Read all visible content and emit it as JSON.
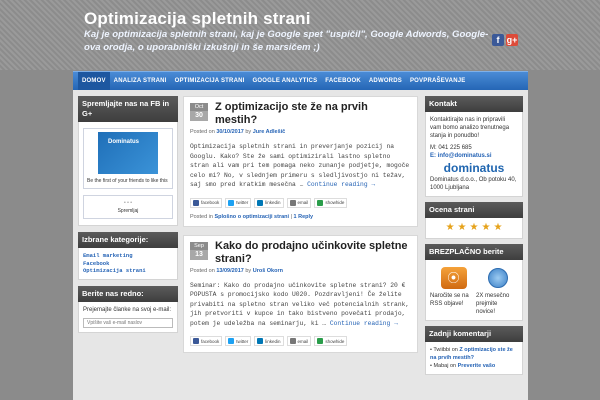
{
  "site": {
    "title": "Optimizacija spletnih strani",
    "tagline": "Kaj je optimizacija spletnih strani, kaj je Google spet \"uspičil\", Google Adwords, Google-ova orodja, o uporabniški izkušnji in še marsičem ;)"
  },
  "social_icons": [
    "facebook-icon",
    "google-plus-icon"
  ],
  "nav": [
    "DOMOV",
    "ANALIZA STRANI",
    "OPTIMIZACIJA STRANI",
    "GOOGLE ANALYTICS",
    "FACEBOOK",
    "ADWORDS",
    "POVPRAŠEVANJE"
  ],
  "left": {
    "fb_title": "Spremljajte nas na FB in G+",
    "fb_page_name": "Dominatus",
    "fb_friends": "Be the first of your friends to like this",
    "follow_btn": "Spremljaj",
    "categories_title": "Izbrane kategorije:",
    "categories": [
      "Email marketing",
      "Facebook",
      "Optimizacija strani"
    ],
    "newsletter_title": "Berite nas redno:",
    "newsletter_text": "Prejemajte članke na svoj e-mail:",
    "newsletter_placeholder": "Vpišite vaš e-mail naslov"
  },
  "posts": [
    {
      "day_label": "Oct",
      "day": "30",
      "title": "Z optimizacijo ste že na prvih mestih?",
      "posted_on": "Posted on",
      "date": "30/10/2017",
      "by": "by",
      "author": "Jure Adlešič",
      "excerpt": "Optimizacija spletnih strani in preverjanje pozicij na Googlu. Kako? Ste že sami optimizirali lastno spletno stran ali vam pri tem pomaga neko zunanje podjetje, mogoče celo mi? No, v slednjem primeru s sledljivostjo ni težav, saj smo pred kratkim mesečna …",
      "more": "Continue reading →",
      "shares": [
        "facebook",
        "twitter",
        "linkedin",
        "email",
        "showhide"
      ],
      "posted_in": "Posted in",
      "category": "Splošno o optimizaciji strani",
      "reply": "1 Reply"
    },
    {
      "day_label": "Sep",
      "day": "13",
      "title": "Kako do prodajno učinkovite spletne strani?",
      "posted_on": "Posted on",
      "date": "13/09/2017",
      "by": "by",
      "author": "Uroš Okorn",
      "excerpt": "Seminar: Kako do prodajno učinkovite spletne strani? 20 € POPUSTA s promocijsko kodo U020. Pozdravljeni! Če želite privabiti na spletno stran veliko več potencialnih strank, jih pretvoriti v kupce in tako bistveno povečati prodajo, potem je udeležba na seminarju, ki …",
      "more": "Continue reading →",
      "shares": [
        "facebook",
        "twitter",
        "linkedin",
        "email",
        "showhide"
      ]
    }
  ],
  "right": {
    "contact_title": "Kontakt",
    "contact_text": "Kontaktirajte nas in pripravili vam bomo analizo trenutnega stanja in ponudbo!",
    "phone": "M: 041 225 685",
    "email": "E: info@dominatus.si",
    "logo_text": "dominatus",
    "address": "Dominatus d.o.o., Ob potoku 40, 1000 Ljubljana",
    "rating_title": "Ocena strani",
    "stars": 5,
    "free_title": "BREZPLAČNO berite",
    "rss_text": "Naročite se na RSS objave!",
    "mail_text": "2X mesečno prejmite novice!",
    "comments_title": "Zadnji komentarji",
    "comments": [
      {
        "author": "Twiibbi",
        "on": "on",
        "title": "Z optimizacijo ste že na prvih mestih?"
      },
      {
        "author": "Mabaj",
        "on": "on",
        "title": "Preverite vašo"
      }
    ]
  },
  "colors": {
    "nav": "#2f73c4",
    "link": "#2563b5",
    "widget_title": "#4a4a4a"
  }
}
